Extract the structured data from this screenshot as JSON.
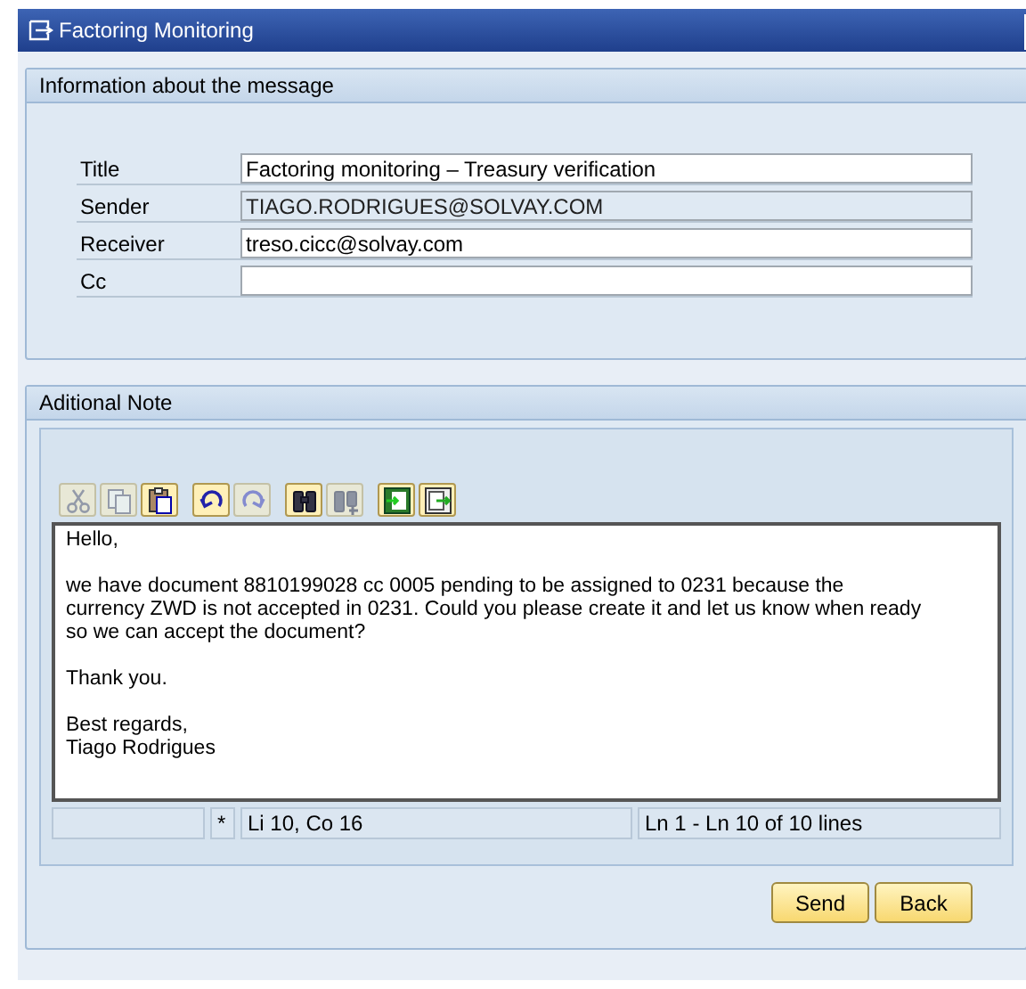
{
  "window": {
    "title": "Factoring Monitoring"
  },
  "message_info": {
    "heading": "Information about the message",
    "fields": [
      {
        "label": "Title",
        "value": "Factoring monitoring – Treasury verification",
        "disabled": false
      },
      {
        "label": "Sender",
        "value": "TIAGO.RODRIGUES@SOLVAY.COM",
        "disabled": true
      },
      {
        "label": "Receiver",
        "value": "treso.cicc@solvay.com",
        "disabled": false
      },
      {
        "label": "Cc",
        "disabled": false
      }
    ]
  },
  "note": {
    "heading": "Aditional Note",
    "toolbar": [
      {
        "kind": "cut",
        "disabled": true
      },
      {
        "kind": "copy",
        "disabled": true
      },
      {
        "kind": "paste",
        "disabled": false
      },
      {
        "kind": "undo",
        "disabled": false
      },
      {
        "kind": "redo",
        "disabled": true
      },
      {
        "kind": "find",
        "disabled": false
      },
      {
        "kind": "find-next",
        "disabled": true
      },
      {
        "kind": "upload",
        "disabled": false
      },
      {
        "kind": "download",
        "disabled": false
      }
    ],
    "paragraphs": [
      [
        "Hello,"
      ],
      [
        "we have document 8810199028 cc 0005 pending to be assigned to 0231 because the currency ZWD is not accepted in 0231. Could you please create it and let us know when ready so we can accept the document?"
      ],
      [
        "Thank you."
      ],
      [
        "Best regards,",
        "Tiago Rodrigues"
      ]
    ],
    "status": {
      "modified": "*",
      "cursor": "Li 10, Co 16",
      "range": "Ln 1 - Ln 10 of 10 lines"
    }
  },
  "buttons": [
    "Send",
    "Back"
  ]
}
